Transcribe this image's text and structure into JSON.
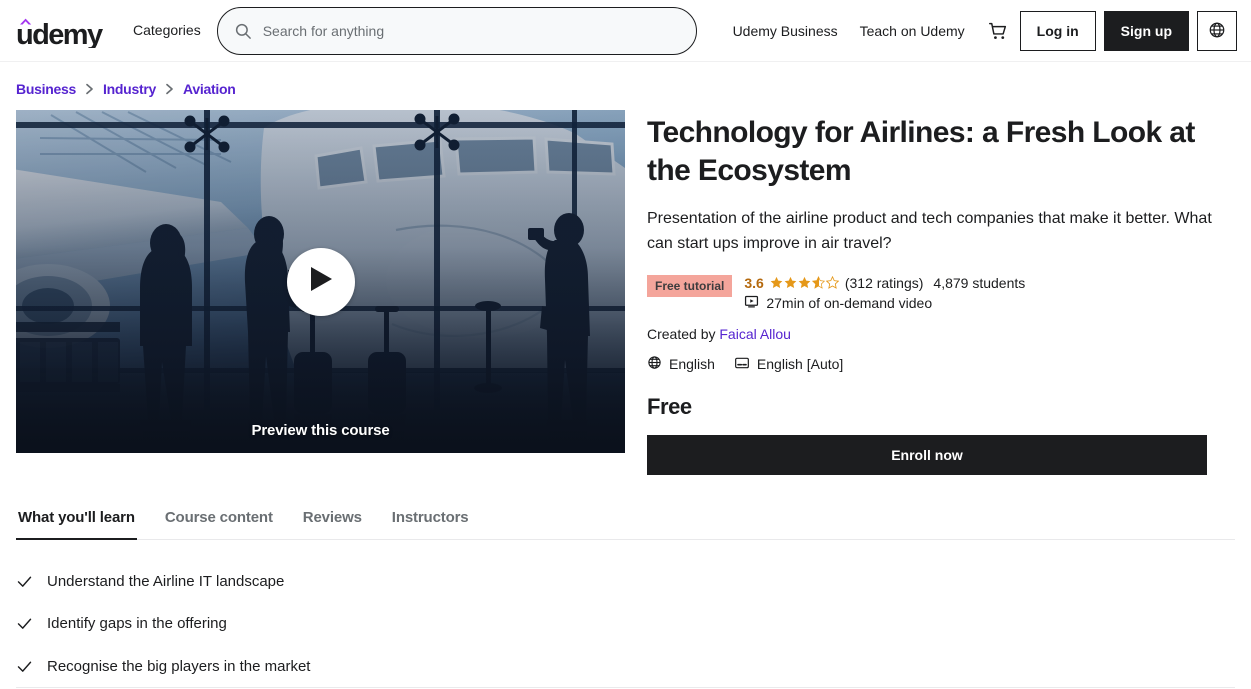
{
  "header": {
    "logo_alt": "Udemy",
    "categories_label": "Categories",
    "search": {
      "placeholder": "Search for anything",
      "value": "",
      "icon": "search-icon"
    },
    "links": [
      {
        "label": "Udemy Business",
        "name": "udemy-business"
      },
      {
        "label": "Teach on Udemy",
        "name": "teach-on-udemy"
      }
    ],
    "cart_icon": "shopping-cart-icon",
    "login_label": "Log in",
    "signup_label": "Sign up",
    "language_icon": "globe-icon"
  },
  "breadcrumb": {
    "separator": "›",
    "items": [
      {
        "label": "Business"
      },
      {
        "label": "Industry"
      },
      {
        "label": "Aviation"
      }
    ]
  },
  "preview": {
    "caption": "Preview this course",
    "play_icon": "play-icon",
    "image_alt": "Silhouettes of travellers watching an airplane through an airport terminal window"
  },
  "course": {
    "title": "Technology for Airlines: a Fresh Look at the Ecosystem",
    "headline": "Presentation of the airline product and tech companies that make it better. What can start ups improve in air travel?",
    "badge": "Free tutorial",
    "rating": "3.6",
    "rating_value": 3.6,
    "rating_count": "(312 ratings)",
    "students": "4,879 students",
    "duration": "27min of on-demand video",
    "duration_icon": "video-monitor-icon",
    "created_by_label": "Created by",
    "instructor": "Faical Allou",
    "language": "English",
    "language_icon": "globe-icon",
    "captions": "English [Auto]",
    "captions_icon": "closed-caption-icon",
    "price": "Free",
    "enroll_label": "Enroll now"
  },
  "tabs": [
    {
      "label": "What you'll learn",
      "active": true
    },
    {
      "label": "Course content",
      "active": false
    },
    {
      "label": "Reviews",
      "active": false
    },
    {
      "label": "Instructors",
      "active": false
    }
  ],
  "learn": {
    "check_icon": "check-icon",
    "items": [
      {
        "text": "Understand the Airline IT landscape"
      },
      {
        "text": "Identify gaps in the offering"
      },
      {
        "text": "Recognise the big players in the market"
      }
    ]
  },
  "colors": {
    "brand_purple": "#5624d0",
    "logo_accent": "#a435f0",
    "rating_amber": "#b4690e",
    "star_amber": "#e59819",
    "badge_bg": "#f4a59b",
    "ink": "#1c1d1f",
    "muted": "#6a6f73"
  }
}
